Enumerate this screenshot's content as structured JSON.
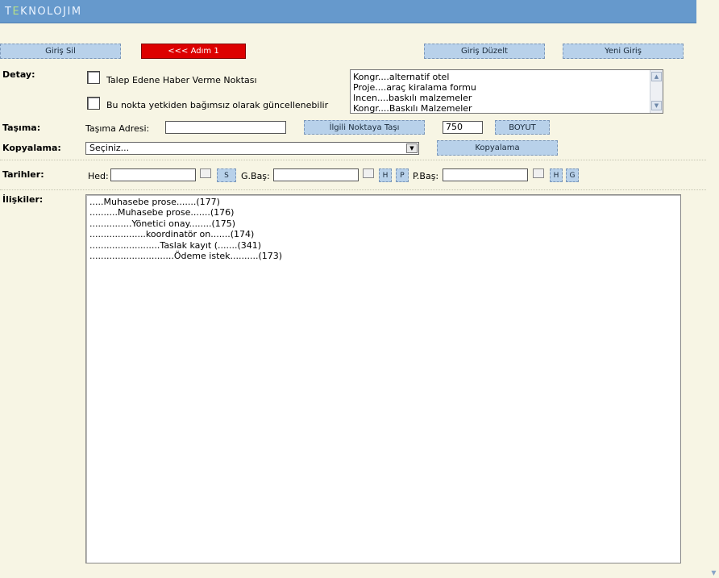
{
  "app": {
    "logo_prefix": "T",
    "logo_accent": "E",
    "logo_suffix": "KNOLOJIM"
  },
  "toolbar": {
    "delete_label": "Giriş Sil",
    "step_label": "<<< Adım 1",
    "edit_label": "Giriş Düzelt",
    "new_label": "Yeni Giriş"
  },
  "detay": {
    "label": "Detay:",
    "check1_label": "Talep Edene Haber Verme Noktası",
    "check2_label": "Bu nokta yetkiden bağımsız olarak güncellenebilir",
    "list_items": [
      "Kongr....alternatif otel",
      "Proje....araç kiralama formu",
      "Incen....baskılı malzemeler",
      "Kongr....Baskılı Malzemeler"
    ]
  },
  "tasima": {
    "label": "Taşıma:",
    "address_label": "Taşıma Adresi:",
    "address_value": "",
    "move_button": "İlgili Noktaya Taşı",
    "size_value": "750",
    "size_button": "BOYUT"
  },
  "kopyalama": {
    "label": "Kopyalama:",
    "select_value": "Seçiniz...",
    "button": "Kopyalama"
  },
  "tarihler": {
    "label": "Tarihler:",
    "hed_label": "Hed:",
    "hed_value": "",
    "hed_btn": "S",
    "gbas_label": "G.Baş:",
    "gbas_value": "",
    "gbas_btn1": "H",
    "gbas_btn2": "P",
    "pbas_label": "P.Baş:",
    "pbas_value": "",
    "pbas_btn1": "H",
    "pbas_btn2": "G"
  },
  "iliskiler": {
    "label": "İlişkiler:",
    "lines": [
      ".....Muhasebe prose.......(177)",
      "..........Muhasebe prose.......(176)",
      "...............Yönetici onay........(175)",
      "....................koordinatör on.......(174)",
      ".........................Taslak kayıt (.......(341)",
      "..............................Ödeme istek..........(173)"
    ]
  }
}
